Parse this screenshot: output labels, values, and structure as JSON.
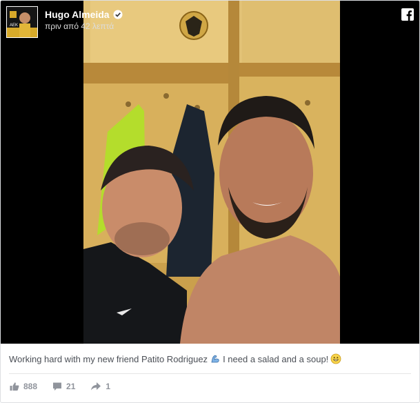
{
  "post": {
    "author": "Hugo Almeida",
    "timestamp": "πριν από 42 λεπτά",
    "verified_icon": "verified-badge-icon",
    "platform_icon": "facebook-logo-icon",
    "avatar_text": "AEK"
  },
  "caption": {
    "text_before": "Working hard with my new friend Patito Rodriguez",
    "text_after": "I need a salad and a soup!",
    "emoji_1": "flexed-biceps-icon",
    "emoji_2": "grinning-face-icon"
  },
  "stats": {
    "likes": "888",
    "comments": "21",
    "shares": "1"
  },
  "colors": {
    "media_background": "#000000",
    "locker_yellow": "#d4b25a",
    "meta_text": "#90949c"
  }
}
